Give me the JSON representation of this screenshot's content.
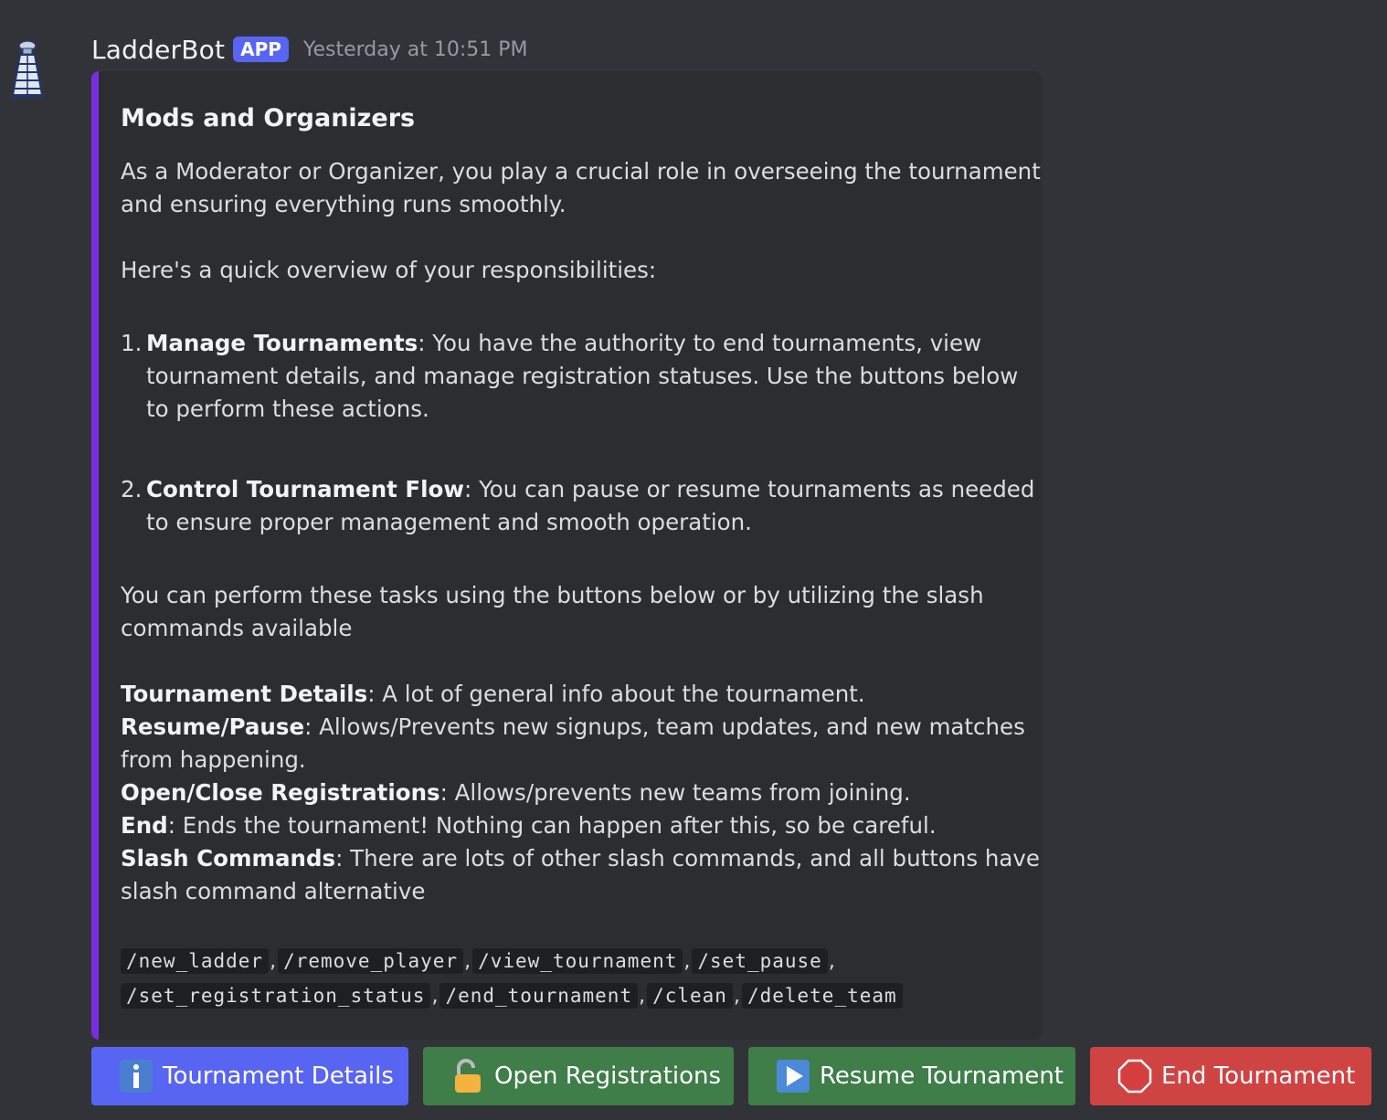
{
  "message": {
    "author": "LadderBot",
    "badge": "APP",
    "timestamp": "Yesterday at 10:51 PM"
  },
  "embed": {
    "accent_color": "#7a2de0",
    "title": "Mods and Organizers",
    "intro_1": "As a Moderator or Organizer, you play a crucial role in overseeing the tournament",
    "intro_2": "and ensuring everything runs smoothly.",
    "overview": "Here's a quick overview of your responsibilities:",
    "item1_num": "1.",
    "item1_bold": "Manage Tournaments",
    "item1_text_1": ": You have the authority to end tournaments, view",
    "item1_text_2": "tournament details, and manage registration statuses. Use the buttons below",
    "item1_text_3": "to perform these actions.",
    "item2_num": "2.",
    "item2_bold": "Control Tournament Flow",
    "item2_text_1": ": You can pause or resume tournaments as needed",
    "item2_text_2": "to ensure proper management and smooth operation.",
    "tasks_1": "You can perform these tasks using the buttons below or by utilizing the slash",
    "tasks_2": "commands available",
    "def1_bold": "Tournament Details",
    "def1_text": ": A lot of general info about the tournament.",
    "def2_bold": "Resume/Pause",
    "def2_text_1": ": Allows/Prevents new signups, team updates, and new matches",
    "def2_text_2": "from happening.",
    "def3_bold": "Open/Close Registrations",
    "def3_text": ": Allows/prevents new teams from joining.",
    "def4_bold": "End",
    "def4_text": ": Ends the tournament! Nothing can happen after this, so be careful.",
    "def5_bold": "Slash Commands",
    "def5_text_1": ": There are lots of other slash commands, and all buttons have a",
    "def5_text_2": "slash command alternative",
    "commands_row1": [
      "/new_ladder",
      "/remove_player",
      "/view_tournament",
      "/set_pause"
    ],
    "commands_row2": [
      "/set_registration_status",
      "/end_tournament",
      "/clean",
      "/delete_team"
    ],
    "separator": ","
  },
  "buttons": {
    "details": {
      "label": "Tournament Details",
      "icon": "info-icon",
      "color": "#5865f2"
    },
    "registrations": {
      "label": "Open Registrations",
      "icon": "unlocked-padlock-icon",
      "color": "#3f7d49"
    },
    "resume": {
      "label": "Resume Tournament",
      "icon": "play-icon",
      "color": "#3f7d49"
    },
    "end": {
      "label": "End Tournament",
      "icon": "stop-octagon-icon",
      "color": "#cf4342"
    }
  }
}
